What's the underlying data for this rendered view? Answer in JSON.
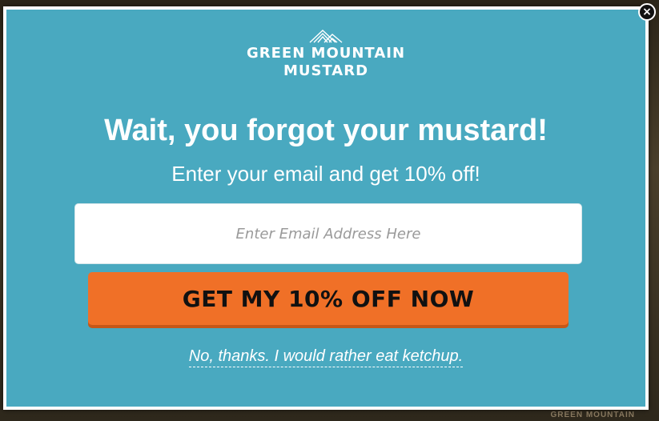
{
  "popup": {
    "close_icon": "×",
    "brand": {
      "line1": "GREEN MOUNTAIN",
      "line2": "MUSTARD",
      "logo_icon": "mountain-icon"
    },
    "headline": "Wait, you forgot your mustard!",
    "subhead": "Enter your email and get 10% off!",
    "email_placeholder": "Enter Email Address Here",
    "email_value": "",
    "cta_label": "GET MY 10% OFF NOW",
    "decline_label": "No, thanks. I would rather eat ketchup."
  },
  "background": {
    "footer_brand": "GREEN MOUNTAIN"
  },
  "colors": {
    "modal_bg": "#49a9c0",
    "cta_bg": "#f07027",
    "text": "#ffffff"
  }
}
